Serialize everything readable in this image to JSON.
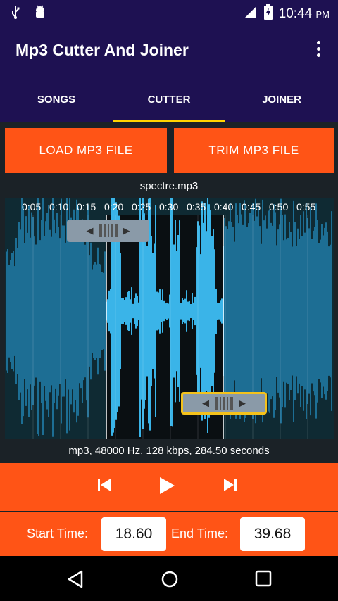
{
  "status_bar": {
    "icons": [
      "usb-icon",
      "android-debug-icon",
      "signal-icon",
      "battery-charging-icon"
    ],
    "time": "10:44",
    "ampm": "PM"
  },
  "app_bar": {
    "title": "Mp3 Cutter And Joiner"
  },
  "tabs": [
    {
      "label": "SONGS",
      "active": false
    },
    {
      "label": "CUTTER",
      "active": true
    },
    {
      "label": "JOINER",
      "active": false
    }
  ],
  "actions": {
    "load_label": "LOAD MP3 FILE",
    "trim_label": "TRIM MP3 FILE"
  },
  "file": {
    "name": "spectre.mp3",
    "info": "mp3, 48000 Hz, 128 kbps, 284.50 seconds"
  },
  "timeline": {
    "ticks": [
      "0:05",
      "0:10",
      "0:15",
      "0:20",
      "0:25",
      "0:30",
      "0:35",
      "0:40",
      "0:45",
      "0:50",
      "0:55"
    ]
  },
  "selection": {
    "start_time_label": "Start Time:",
    "start_time": "18.60",
    "end_time_label": "End Time:",
    "end_time": "39.68"
  },
  "colors": {
    "app_bar": "#1e1152",
    "accent": "#ff5416",
    "tab_indicator": "#ffd400",
    "waveform": "#1d6e94",
    "waveform_selected": "#3ab4e8",
    "end_handle_border": "#f4c21b"
  }
}
